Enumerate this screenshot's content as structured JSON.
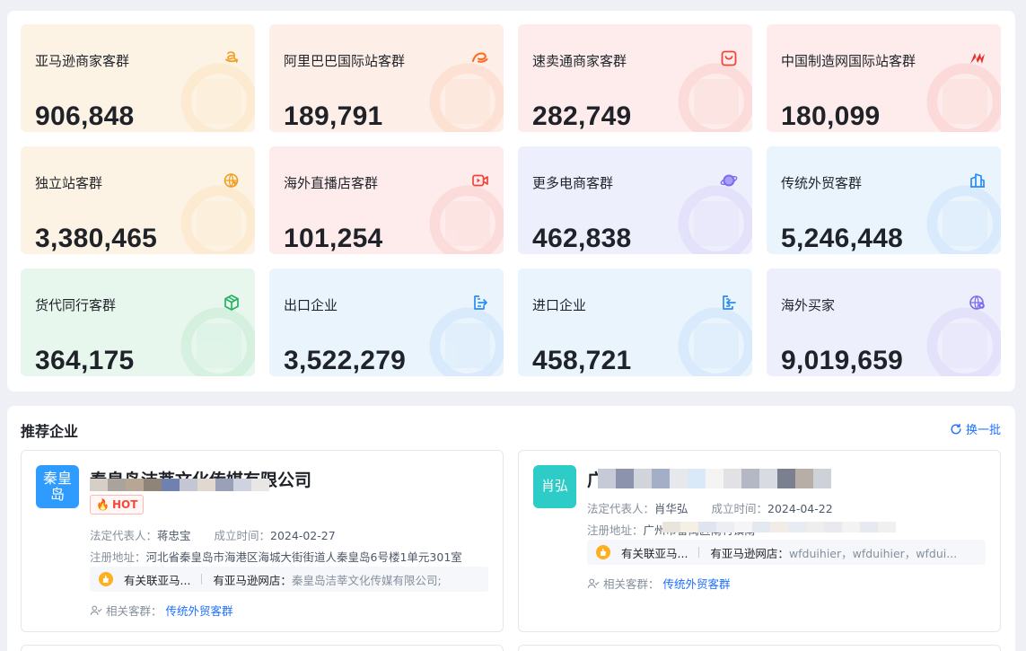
{
  "stats": [
    {
      "title": "亚马逊商家客群",
      "value": "906,848",
      "icon": "amazon-icon",
      "bg": "#fdf3e4",
      "accent": "#f29b1d"
    },
    {
      "title": "阿里巴巴国际站客群",
      "value": "189,791",
      "icon": "alibaba-icon",
      "bg": "#fdeee7",
      "accent": "#ff6a1a"
    },
    {
      "title": "速卖通商家客群",
      "value": "282,749",
      "icon": "aliexpress-icon",
      "bg": "#fdeceb",
      "accent": "#f0453a"
    },
    {
      "title": "中国制造网国际站客群",
      "value": "180,099",
      "icon": "made-in-china-icon",
      "bg": "#fdeceb",
      "accent": "#e8312b"
    },
    {
      "title": "独立站客群",
      "value": "3,380,465",
      "icon": "globe-cursor-icon",
      "bg": "#fdf3e4",
      "accent": "#f29b1d"
    },
    {
      "title": "海外直播店客群",
      "value": "101,254",
      "icon": "video-icon",
      "bg": "#fdeceb",
      "accent": "#f0453a"
    },
    {
      "title": "更多电商客群",
      "value": "462,838",
      "icon": "planet-icon",
      "bg": "#eeeffc",
      "accent": "#7a6cf0"
    },
    {
      "title": "传统外贸客群",
      "value": "5,246,448",
      "icon": "buildings-icon",
      "bg": "#eaf4fd",
      "accent": "#2b8bf2"
    },
    {
      "title": "货代同行客群",
      "value": "364,175",
      "icon": "box-icon",
      "bg": "#e8f7ee",
      "accent": "#24b360"
    },
    {
      "title": "出口企业",
      "value": "3,522,279",
      "icon": "export-icon",
      "bg": "#eaf4fd",
      "accent": "#2b8bf2"
    },
    {
      "title": "进口企业",
      "value": "458,721",
      "icon": "import-icon",
      "bg": "#eaf4fd",
      "accent": "#2b8bf2"
    },
    {
      "title": "海外买家",
      "value": "9,019,659",
      "icon": "globe-location-icon",
      "bg": "#eeeffc",
      "accent": "#7a6cf0"
    }
  ],
  "recommend": {
    "title": "推荐企业",
    "refresh_label": "换一批",
    "companies": [
      {
        "logo_text": "秦皇岛",
        "logo_color": "#2f9bff",
        "name": "秦皇岛洁莘文化传媒有限公司",
        "hot_label": "HOT",
        "legal_rep_label": "法定代表人：",
        "legal_rep": "蒋忠宝",
        "founded_label": "成立时间：",
        "founded": "2024-02-27",
        "address_label": "注册地址：",
        "address": "河北省秦皇岛市海港区海城大街街道人秦皇岛6号楼1单元301室",
        "store_flag": "有关联亚马...",
        "store_label": "有亚马逊网店：",
        "store_value": "秦皇岛洁莘文化传媒有限公司;"
      },
      {
        "logo_text": "肖弘",
        "logo_color": "#2dccc6",
        "name": "广",
        "hot_label": "",
        "legal_rep_label": "法定代表人：",
        "legal_rep": "肖华弘",
        "founded_label": "成立时间：",
        "founded": "2024-04-22",
        "address_label": "注册地址：",
        "address": "广州市番禺区南村镇南",
        "store_flag": "有关联亚马...",
        "store_label": "有亚马逊网店：",
        "store_value": "wfduihier，wfduihier，wfdui..."
      }
    ],
    "related_label": "相关客群：",
    "related_links": [
      "传统外贸客群",
      "传统外贸客群"
    ]
  }
}
